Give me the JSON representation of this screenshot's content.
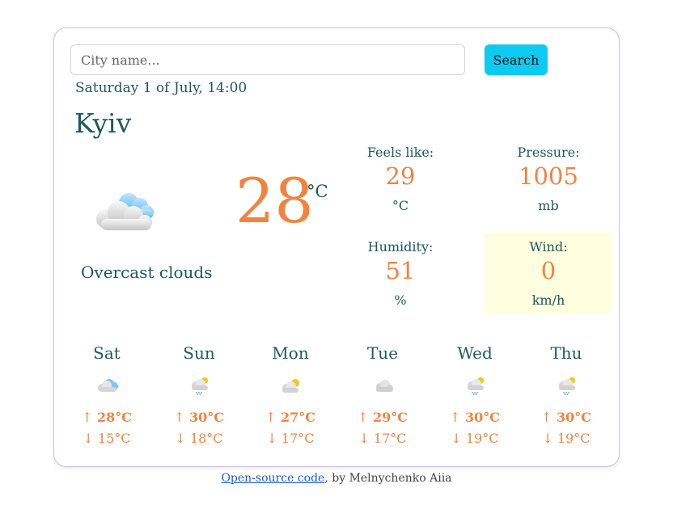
{
  "search": {
    "placeholder": "City name...",
    "button_label": "Search"
  },
  "current": {
    "date": "Saturday 1 of July, 14:00",
    "city": "Kyiv",
    "temperature": "28",
    "unit": "°C",
    "condition": "Overcast clouds",
    "icon": "overcast-clouds-icon"
  },
  "stats": {
    "feels_like": {
      "label": "Feels like:",
      "value": "29",
      "unit": "°C"
    },
    "pressure": {
      "label": "Pressure:",
      "value": "1005",
      "unit": "mb"
    },
    "humidity": {
      "label": "Humidity:",
      "value": "51",
      "unit": "%"
    },
    "wind": {
      "label": "Wind:",
      "value": "0",
      "unit": "km/h"
    }
  },
  "forecast": [
    {
      "day": "Sat",
      "icon": "broken-clouds-icon",
      "high": "28°C",
      "low": "15°C"
    },
    {
      "day": "Sun",
      "icon": "rain-sun-icon",
      "high": "30°C",
      "low": "18°C"
    },
    {
      "day": "Mon",
      "icon": "few-clouds-icon",
      "high": "27°C",
      "low": "17°C"
    },
    {
      "day": "Tue",
      "icon": "overcast-clouds-icon",
      "high": "29°C",
      "low": "17°C"
    },
    {
      "day": "Wed",
      "icon": "rain-sun-icon",
      "high": "30°C",
      "low": "19°C"
    },
    {
      "day": "Thu",
      "icon": "rain-sun-icon",
      "high": "30°C",
      "low": "19°C"
    }
  ],
  "footer": {
    "link_text": "Open-source code",
    "suffix": ", by Melnychenko Aiia"
  },
  "colors": {
    "accent": "#f2833f",
    "text": "#1d5a5a",
    "button": "#0dcaf0",
    "wind_highlight": "#ffffe0"
  }
}
